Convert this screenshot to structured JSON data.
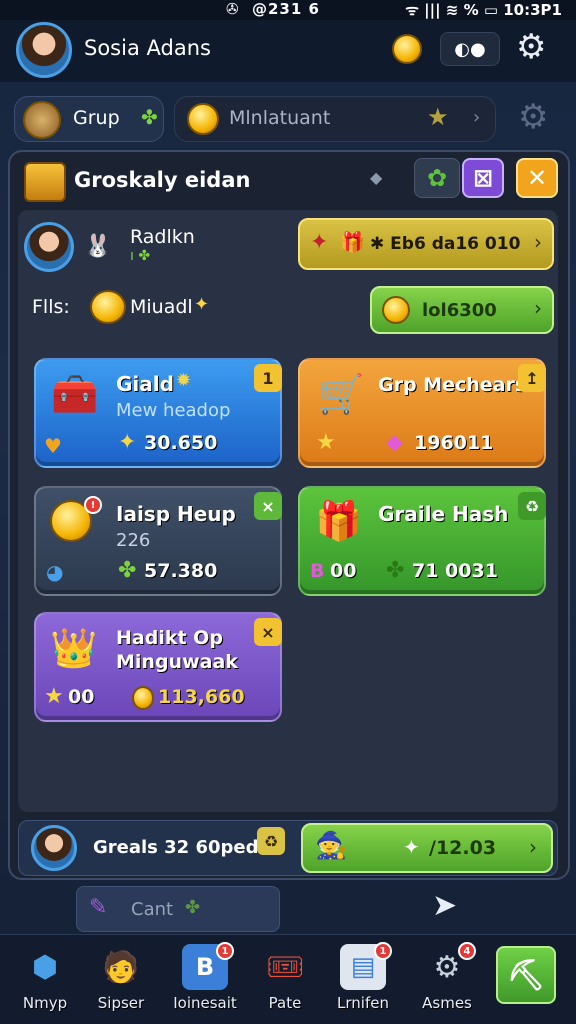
{
  "status_bar": {
    "center": "@231 6",
    "right": "ᯤ ||| ≋ % ▭ 10:3P1"
  },
  "profile": {
    "name": "Sosia Adans"
  },
  "tabs": [
    {
      "label": "Grup"
    },
    {
      "label": "Mlnlatuant"
    }
  ],
  "panel": {
    "title": "Groskaly eidan",
    "player": {
      "name": "Radlkn",
      "reward_text": "✱ Eb6 da16 010"
    },
    "fils": {
      "label": "Flls:",
      "name": "Miuadl",
      "coins": "lol6300"
    },
    "cards": [
      {
        "title": "Giald",
        "subtitle": "Mew headop",
        "value": "30.650",
        "badge": "1",
        "color": "blue"
      },
      {
        "title": "Grp Mechears",
        "subtitle": "",
        "value": "196011",
        "badge": "↥",
        "color": "orange"
      },
      {
        "title": "Iaisp Heup",
        "subtitle": "226",
        "value": "57.380",
        "badge": "×",
        "color": "gray"
      },
      {
        "title": "Graile Hash",
        "subtitle": "",
        "left_value": "00",
        "value": "71 0031",
        "badge": "♻",
        "color": "green"
      },
      {
        "title": "Hadikt Op Minguwaak",
        "subtitle": "",
        "left_value": "00",
        "value": "113,660",
        "badge": "×",
        "color": "purple"
      }
    ]
  },
  "bottom_bar": {
    "label": "Greals 32 60pedio",
    "value": "/12.03"
  },
  "cant_label": "Cant",
  "nav": [
    {
      "label": "Nmyp"
    },
    {
      "label": "Sipser"
    },
    {
      "label": "Ioinesait"
    },
    {
      "label": "Pate"
    },
    {
      "label": "Lrnifen"
    },
    {
      "label": "Asmes"
    }
  ],
  "colors": {
    "accent_yellow": "#f2c230",
    "accent_green": "#55c13a",
    "panel_bg": "#2a3548"
  }
}
